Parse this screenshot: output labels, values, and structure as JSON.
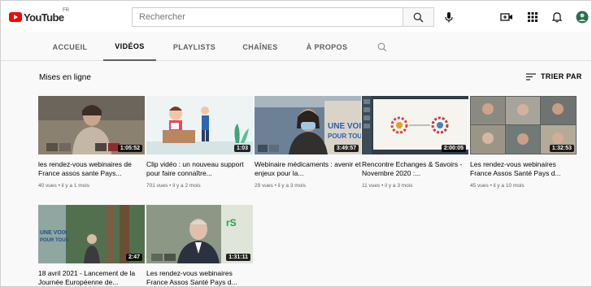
{
  "masthead": {
    "logo_text": "YouTube",
    "logo_country": "FR",
    "search_placeholder": "Rechercher"
  },
  "tabs": [
    {
      "label": "ACCUEIL",
      "active": false
    },
    {
      "label": "VIDÉOS",
      "active": true
    },
    {
      "label": "PLAYLISTS",
      "active": false
    },
    {
      "label": "CHAÎNES",
      "active": false
    },
    {
      "label": "À PROPOS",
      "active": false
    }
  ],
  "section": {
    "title": "Mises en ligne",
    "sort_label": "TRIER PAR"
  },
  "videos": [
    {
      "title": "les rendez-vous webinaires de France assos sante Pays...",
      "meta": "40 vues • il y a 1 mois",
      "duration": "1:05:52"
    },
    {
      "title": "Clip vidéo : un nouveau support pour faire connaître...",
      "meta": "701 vues • il y a 2 mois",
      "duration": "1:03"
    },
    {
      "title": "Webinaire médicaments : avenir et enjeux pour la...",
      "meta": "29 vues • il y a 3 mois",
      "duration": "3:49:57"
    },
    {
      "title": "Rencontre Echanges & Savoirs - Novembre 2020 :...",
      "meta": "11 vues • il y a 3 mois",
      "duration": "2:00:05"
    },
    {
      "title": "Les rendez-vous webinaires France Assos Santé Pays d...",
      "meta": "45 vues • il y a 10 mois",
      "duration": "1:32:53"
    },
    {
      "title": "18 avril 2021 - Lancement de la Journée Européenne de...",
      "meta": "",
      "duration": "2:47"
    },
    {
      "title": "Les rendez-vous webinaires France Assos Santé Pays d...",
      "meta": "",
      "duration": "1:31:11"
    }
  ],
  "thumb_text": {
    "une_voix": "UNE VOIX",
    "pour_tous": "POUR TOUS",
    "rs": "rS"
  },
  "colors": {
    "brand_red": "#ff0000",
    "background": "#f9f9f9",
    "text_secondary": "#606060"
  }
}
